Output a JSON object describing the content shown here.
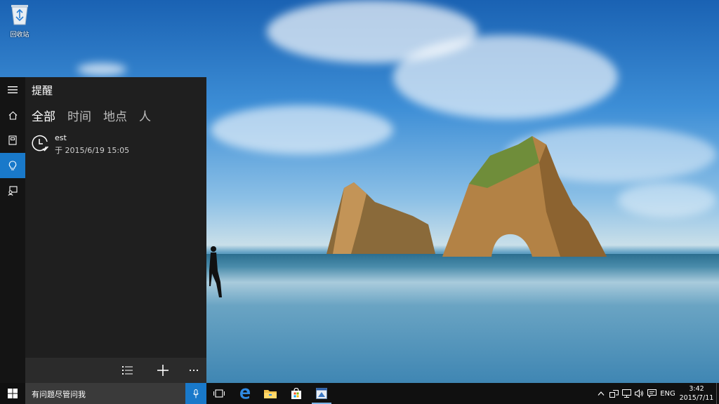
{
  "desktop": {
    "recycle_bin_label": "回收站"
  },
  "cortana": {
    "title": "提醒",
    "tabs": [
      {
        "label": "全部",
        "active": true
      },
      {
        "label": "时间",
        "active": false
      },
      {
        "label": "地点",
        "active": false
      },
      {
        "label": "人",
        "active": false
      }
    ],
    "rail": [
      {
        "icon": "hamburger-menu-icon"
      },
      {
        "icon": "home-icon"
      },
      {
        "icon": "notebook-icon"
      },
      {
        "icon": "lightbulb-icon",
        "active": true
      },
      {
        "icon": "feedback-icon"
      }
    ],
    "reminders": [
      {
        "icon": "clock-check-icon",
        "name": "est",
        "when": "于 2015/6/19 15:05"
      }
    ],
    "toolbar": [
      {
        "icon": "list-icon"
      },
      {
        "icon": "plus-icon"
      },
      {
        "icon": "more-icon"
      }
    ]
  },
  "taskbar": {
    "search_placeholder": "有问题尽管问我",
    "pinned": [
      {
        "icon": "task-view-icon"
      },
      {
        "icon": "edge-icon"
      },
      {
        "icon": "file-explorer-icon"
      },
      {
        "icon": "store-icon"
      },
      {
        "icon": "app-window-icon",
        "running": true
      }
    ],
    "tray": {
      "input_language": "ENG",
      "time": "3:42",
      "date": "2015/7/11"
    }
  },
  "colors": {
    "accent": "#1979ca",
    "panel_bg": "#1f1f1f",
    "rail_bg": "#141414",
    "taskbar_bg": "#101010"
  }
}
